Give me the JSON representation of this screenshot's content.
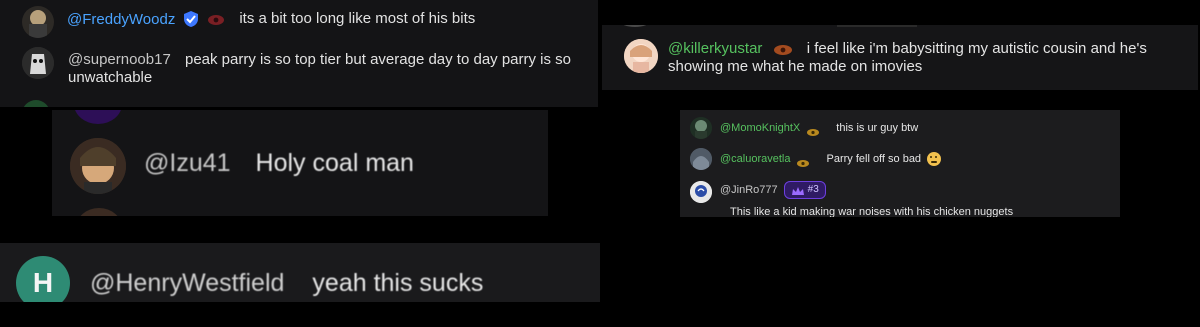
{
  "colors": {
    "background": "#000000",
    "panel": "#161618",
    "username_blue": "#4aa3ff",
    "username_green": "#56c15f",
    "username_gray": "#c6c6c6",
    "message_text": "#e8e8e8",
    "rank_purple": "#6d3fe0"
  },
  "panel1": {
    "comments": [
      {
        "username": "@FreddyWoodz",
        "message": "its a bit too long like most of his bits",
        "badges": [
          "shield-icon",
          "eye-icon"
        ]
      },
      {
        "username": "@supernoob17",
        "message": "peak parry is so top tier but average day to day parry is so unwatchable",
        "badges": []
      }
    ]
  },
  "panel2": {
    "comment": {
      "username": "@Izu41",
      "message": "Holy coal man"
    }
  },
  "panel3": {
    "comment": {
      "avatar_letter": "H",
      "username": "@HenryWestfield",
      "message": "yeah this sucks"
    }
  },
  "panel4": {
    "comment": {
      "username": "@killerkyustar",
      "message": "i feel like i'm babysitting my autistic cousin and he's showing me what he made on imovies",
      "badges": [
        "eye-icon"
      ]
    }
  },
  "panel5": {
    "comments": [
      {
        "username": "@MomoKnightX",
        "message": "this is ur guy btw",
        "badges": [
          "eye-icon"
        ]
      },
      {
        "username": "@caluoravetla",
        "message": "Parry fell off so bad",
        "emoji": "face-icon",
        "badges": [
          "eye-icon"
        ]
      },
      {
        "username": "@JinRo777",
        "rank": "#3",
        "message": "This like a kid making war noises with his chicken nuggets",
        "badges": [
          "crown-icon"
        ]
      }
    ]
  }
}
